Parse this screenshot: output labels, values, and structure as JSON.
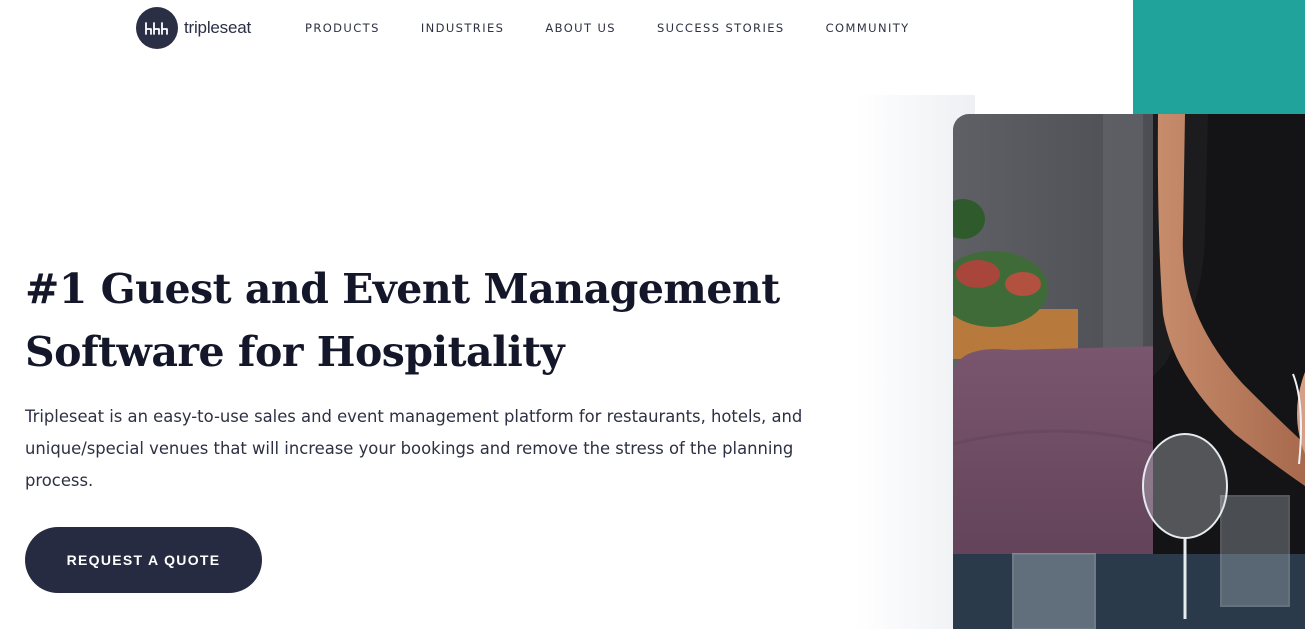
{
  "brand": {
    "name": "tripleseat",
    "logo_icon": "triple-seat-chairs-icon",
    "color": "#2a2f45"
  },
  "nav": {
    "items": [
      {
        "label": "PRODUCTS"
      },
      {
        "label": "INDUSTRIES"
      },
      {
        "label": "ABOUT US"
      },
      {
        "label": "SUCCESS STORIES"
      },
      {
        "label": "COMMUNITY"
      }
    ]
  },
  "hero": {
    "title_line1": "#1 Guest and Event Management",
    "title_line2": "Software for Hospitality",
    "description": "Tripleseat is an easy-to-use sales and event management platform for restaurants, hotels, and unique/special venues that will increase your bookings and remove the stress of the planning process.",
    "cta_label": "REQUEST A QUOTE"
  },
  "colors": {
    "accent_teal": "#1fa39b",
    "cta_bg": "#272b42",
    "heading": "#14172a",
    "body_text": "#2d3142"
  }
}
